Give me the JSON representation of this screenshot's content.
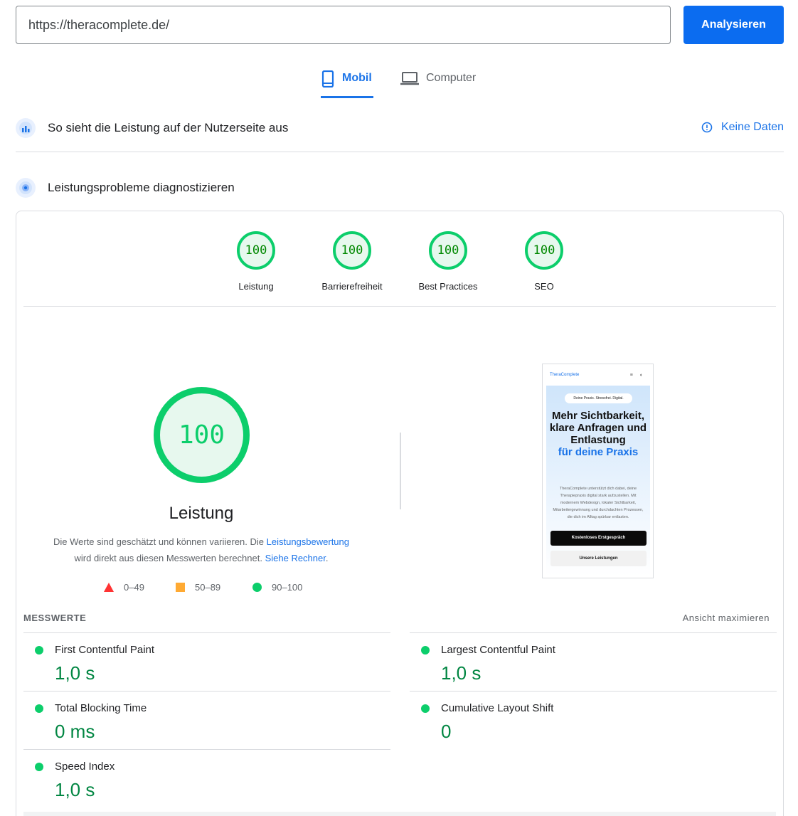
{
  "search": {
    "url": "https://theracomplete.de/",
    "button_label": "Analysieren"
  },
  "tabs": [
    {
      "label": "Mobil",
      "icon": "phone-icon",
      "active": true
    },
    {
      "label": "Computer",
      "icon": "laptop-icon",
      "active": false
    }
  ],
  "field_section": {
    "title": "So sieht die Leistung auf der Nutzerseite aus",
    "no_data_label": "Keine Daten"
  },
  "diagnose_section": {
    "title": "Leistungsprobleme diagnostizieren"
  },
  "categories": [
    {
      "score": "100",
      "label": "Leistung"
    },
    {
      "score": "100",
      "label": "Barrierefreiheit"
    },
    {
      "score": "100",
      "label": "Best Practices"
    },
    {
      "score": "100",
      "label": "SEO"
    }
  ],
  "performance": {
    "score": "100",
    "title": "Leistung",
    "explain_pre": "Die Werte sind geschätzt und können variieren. Die ",
    "explain_link1": "Leistungsbewertung",
    "explain_mid": "wird direkt aus diesen Messwerten berechnet. ",
    "explain_link2": "Siehe Rechner",
    "explain_post": ".",
    "legend": [
      {
        "range": "0–49",
        "color": "#ff3333",
        "shape": "triangle"
      },
      {
        "range": "50–89",
        "color": "#ffaa33",
        "shape": "square"
      },
      {
        "range": "90–100",
        "color": "#0cce6b",
        "shape": "circle"
      }
    ]
  },
  "screenshot": {
    "brand": "TheraComplete",
    "badge": "Deine Praxis. Stressfrei. Digital.",
    "headline": "Mehr Sichtbarkeit, klare Anfragen und Entlastung",
    "headline_accent": "für deine Praxis",
    "body": "TheraComplete unterstützt dich dabei, deine Therapiepraxis digital stark aufzustellen. Mit modernem Webdesign, lokaler Sichtbarkeit, Mitarbeitergewinnung und durchdachten Prozessen, die dich im Alltag spürbar entlasten.",
    "primary_cta": "Kostenloses Erstgespräch",
    "secondary_cta": "Unsere Leistungen"
  },
  "metrics": {
    "heading": "MESSWERTE",
    "maximize_label": "Ansicht maximieren",
    "items": [
      {
        "label": "First Contentful Paint",
        "value": "1,0 s",
        "status": "good"
      },
      {
        "label": "Largest Contentful Paint",
        "value": "1,0 s",
        "status": "good"
      },
      {
        "label": "Total Blocking Time",
        "value": "0 ms",
        "status": "good"
      },
      {
        "label": "Cumulative Layout Shift",
        "value": "0",
        "status": "good"
      },
      {
        "label": "Speed Index",
        "value": "1,0 s",
        "status": "good"
      }
    ]
  },
  "colors": {
    "good": "#0cce6b",
    "accent": "#1a73e8",
    "primary_button": "#0b6cf0"
  }
}
